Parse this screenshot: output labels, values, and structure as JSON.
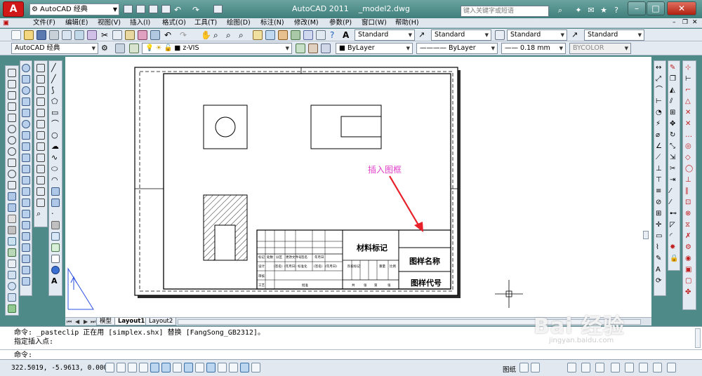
{
  "title_bar": {
    "workspace": "AutoCAD 经典",
    "app_name": "AutoCAD 2011",
    "doc_name": "_model2.dwg",
    "search_placeholder": "键入关键字或短语"
  },
  "menu": [
    "文件(F)",
    "编辑(E)",
    "视图(V)",
    "插入(I)",
    "格式(O)",
    "工具(T)",
    "绘图(D)",
    "标注(N)",
    "修改(M)",
    "参数(P)",
    "窗口(W)",
    "帮助(H)"
  ],
  "styles_toolbar": {
    "text_style": "Standard",
    "dim_style": "Standard",
    "table_style": "Standard",
    "multileader_style": "Standard"
  },
  "properties_toolbar": {
    "workspace": "AutoCAD 经典",
    "layer": "z-VIS",
    "color": "ByLayer",
    "linetype": "ByLayer",
    "lineweight": "0.18 mm",
    "plotstyle": "BYCOLOR"
  },
  "drawing": {
    "annotation": "插入图框",
    "title_block": {
      "material": "材料标记",
      "drawing_name": "图样名称",
      "drawing_code": "图样代号",
      "header_labels": [
        "标记",
        "处数",
        "分区",
        "更改文件号",
        "签名",
        "年月日"
      ],
      "row2_labels": [
        "设计",
        "(签名)",
        "(年月日)",
        "标准化",
        "(签名)",
        "(年月日)"
      ],
      "row3_labels": [
        "审核"
      ],
      "row4_labels": [
        "工艺",
        "批准"
      ],
      "stage_labels": [
        "阶段标记",
        "重量",
        "比例"
      ],
      "sheet_labels": [
        "共",
        "张",
        "第",
        "张"
      ]
    }
  },
  "layout_tabs": [
    "模型",
    "Layout1",
    "Layout2"
  ],
  "command_history": [
    "命令: _pasteclip 正在用 [simplex.shx] 替换 [FangSong_GB2312]。",
    "指定插入点:"
  ],
  "command_prompt": "命令:",
  "status": {
    "coords": "322.5019, -5.9613, 0.0000",
    "space": "图纸"
  },
  "watermark": {
    "brand": "Bai 经验",
    "url": "jingyan.baidu.com"
  },
  "colors": {
    "annotation": "#e040c8",
    "arrow": "#e8202a",
    "title_bar": "#4d8a88"
  }
}
